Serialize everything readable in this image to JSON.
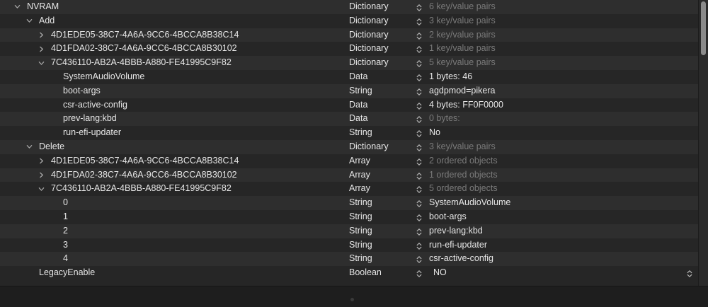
{
  "rows": [
    {
      "key": "NVRAM",
      "type": "Dictionary",
      "value": "6 key/value pairs",
      "depth": 0,
      "disclosure": "down",
      "muted": true
    },
    {
      "key": "Add",
      "type": "Dictionary",
      "value": "3 key/value pairs",
      "depth": 1,
      "disclosure": "down",
      "muted": true
    },
    {
      "key": "4D1EDE05-38C7-4A6A-9CC6-4BCCA8B38C14",
      "type": "Dictionary",
      "value": "2 key/value pairs",
      "depth": 2,
      "disclosure": "right",
      "muted": true
    },
    {
      "key": "4D1FDA02-38C7-4A6A-9CC6-4BCCA8B30102",
      "type": "Dictionary",
      "value": "1 key/value pairs",
      "depth": 2,
      "disclosure": "right",
      "muted": true
    },
    {
      "key": "7C436110-AB2A-4BBB-A880-FE41995C9F82",
      "type": "Dictionary",
      "value": "5 key/value pairs",
      "depth": 2,
      "disclosure": "down",
      "muted": true
    },
    {
      "key": "SystemAudioVolume",
      "type": "Data",
      "value": "1 bytes: 46",
      "depth": 3,
      "disclosure": "none",
      "muted": false
    },
    {
      "key": "boot-args",
      "type": "String",
      "value": "agdpmod=pikera",
      "depth": 3,
      "disclosure": "none",
      "muted": false
    },
    {
      "key": "csr-active-config",
      "type": "Data",
      "value": "4 bytes: FF0F0000",
      "depth": 3,
      "disclosure": "none",
      "muted": false
    },
    {
      "key": "prev-lang:kbd",
      "type": "Data",
      "value": "0 bytes:",
      "depth": 3,
      "disclosure": "none",
      "muted": true
    },
    {
      "key": "run-efi-updater",
      "type": "String",
      "value": "No",
      "depth": 3,
      "disclosure": "none",
      "muted": false
    },
    {
      "key": "Delete",
      "type": "Dictionary",
      "value": "3 key/value pairs",
      "depth": 1,
      "disclosure": "down",
      "muted": true
    },
    {
      "key": "4D1EDE05-38C7-4A6A-9CC6-4BCCA8B38C14",
      "type": "Array",
      "value": "2 ordered objects",
      "depth": 2,
      "disclosure": "right",
      "muted": true
    },
    {
      "key": "4D1FDA02-38C7-4A6A-9CC6-4BCCA8B30102",
      "type": "Array",
      "value": "1 ordered objects",
      "depth": 2,
      "disclosure": "right",
      "muted": true
    },
    {
      "key": "7C436110-AB2A-4BBB-A880-FE41995C9F82",
      "type": "Array",
      "value": "5 ordered objects",
      "depth": 2,
      "disclosure": "down",
      "muted": true
    },
    {
      "key": "0",
      "type": "String",
      "value": "SystemAudioVolume",
      "depth": 3,
      "disclosure": "none",
      "muted": false
    },
    {
      "key": "1",
      "type": "String",
      "value": "boot-args",
      "depth": 3,
      "disclosure": "none",
      "muted": false
    },
    {
      "key": "2",
      "type": "String",
      "value": "prev-lang:kbd",
      "depth": 3,
      "disclosure": "none",
      "muted": false
    },
    {
      "key": "3",
      "type": "String",
      "value": "run-efi-updater",
      "depth": 3,
      "disclosure": "none",
      "muted": false
    },
    {
      "key": "4",
      "type": "String",
      "value": "csr-active-config",
      "depth": 3,
      "disclosure": "none",
      "muted": false
    },
    {
      "key": "LegacyEnable",
      "type": "Boolean",
      "value": "NO",
      "depth": 1,
      "disclosure": "none",
      "muted": false,
      "boolean": true
    }
  ],
  "colors": {
    "background": "#262626",
    "alt_row": "#2e2e2e",
    "text": "#e6e6e6",
    "muted": "#7a7a7a"
  },
  "icons": {
    "disclosure_open": "chevron-down-icon",
    "disclosure_closed": "chevron-right-icon",
    "type_stepper": "stepper-icon"
  }
}
